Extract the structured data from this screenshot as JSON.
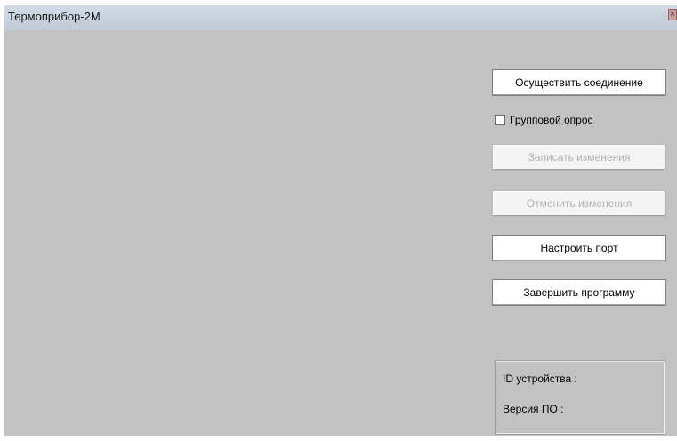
{
  "window": {
    "title": "Термоприбор-2М",
    "close_glyph": "×"
  },
  "buttons": {
    "connect": "Осуществить соединение",
    "save_changes": "Записать изменения",
    "cancel_changes": "Отменить изменения",
    "configure_port": "Настроить порт",
    "exit_program": "Завершить программу"
  },
  "group_poll": {
    "label": "Групповой опрос",
    "checked": false
  },
  "device_info": {
    "device_id_label": "ID устройства :",
    "firmware_version_label": "Версия ПО :"
  }
}
